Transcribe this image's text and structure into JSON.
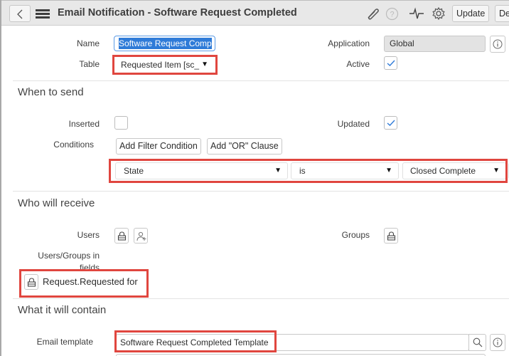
{
  "header": {
    "title": "Email Notification - Software Request Completed",
    "icons": [
      "back-icon",
      "hamburger-menu-icon",
      "paperclip-icon",
      "help-icon",
      "activity-pulse-icon",
      "gear-icon"
    ],
    "update_label": "Update",
    "delete_label": "Del"
  },
  "form": {
    "name_label": "Name",
    "name_value": "Software Request Comp",
    "table_label": "Table",
    "table_value": "Requested Item [sc_",
    "application_label": "Application",
    "application_value": "Global",
    "active_label": "Active",
    "active_checked": true
  },
  "when_to_send": {
    "title": "When to send",
    "inserted_label": "Inserted",
    "inserted_checked": false,
    "updated_label": "Updated",
    "updated_checked": true,
    "conditions_label": "Conditions",
    "add_filter_label": "Add Filter Condition",
    "add_or_label": "Add \"OR\" Clause",
    "condition": {
      "field": "State",
      "operator": "is",
      "value": "Closed Complete"
    }
  },
  "who_will_receive": {
    "title": "Who will receive",
    "users_label": "Users",
    "groups_label": "Groups",
    "users_groups_label_1": "Users/Groups in",
    "users_groups_label_2": "fields",
    "users_groups_value": "Request.Requested for"
  },
  "what_it_will_contain": {
    "title": "What it will contain",
    "email_template_label": "Email template",
    "email_template_value": "Software Request Completed Template"
  },
  "colors": {
    "highlight_red": "#e0463f",
    "accent_blue": "#2f7bd8"
  }
}
